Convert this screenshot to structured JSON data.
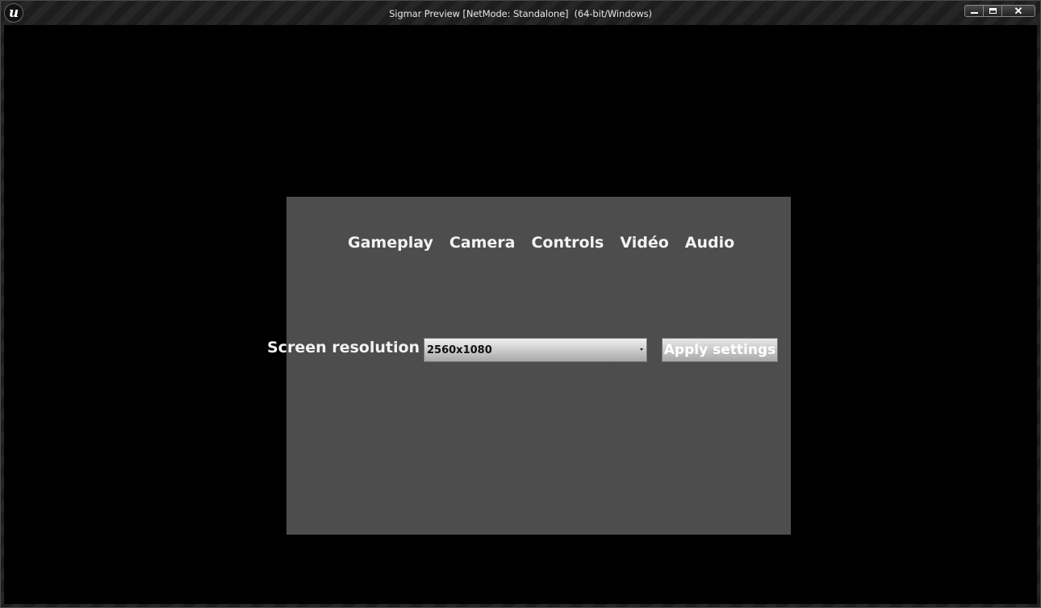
{
  "window": {
    "title": "Sigmar Preview [NetMode: Standalone]  (64-bit/Windows)",
    "logo_glyph": "u",
    "logo_icon": "unreal-engine-logo-icon",
    "controls": {
      "minimize_icon": "minimize-icon",
      "maximize_icon": "maximize-icon",
      "close_icon": "close-icon",
      "close_glyph": "✕"
    }
  },
  "settings": {
    "tabs": [
      {
        "label": "Gameplay"
      },
      {
        "label": "Camera"
      },
      {
        "label": "Controls"
      },
      {
        "label": "Vidéo"
      },
      {
        "label": "Audio"
      }
    ],
    "resolution_label": "Screen resolution :",
    "resolution_value": "2560x1080",
    "dropdown_icon": "chevron-down-icon",
    "apply_label": "Apply settings"
  },
  "colors": {
    "viewport_bg": "#000000",
    "panel_bg": "#4d4d4d",
    "text": "#f2f2f2"
  }
}
